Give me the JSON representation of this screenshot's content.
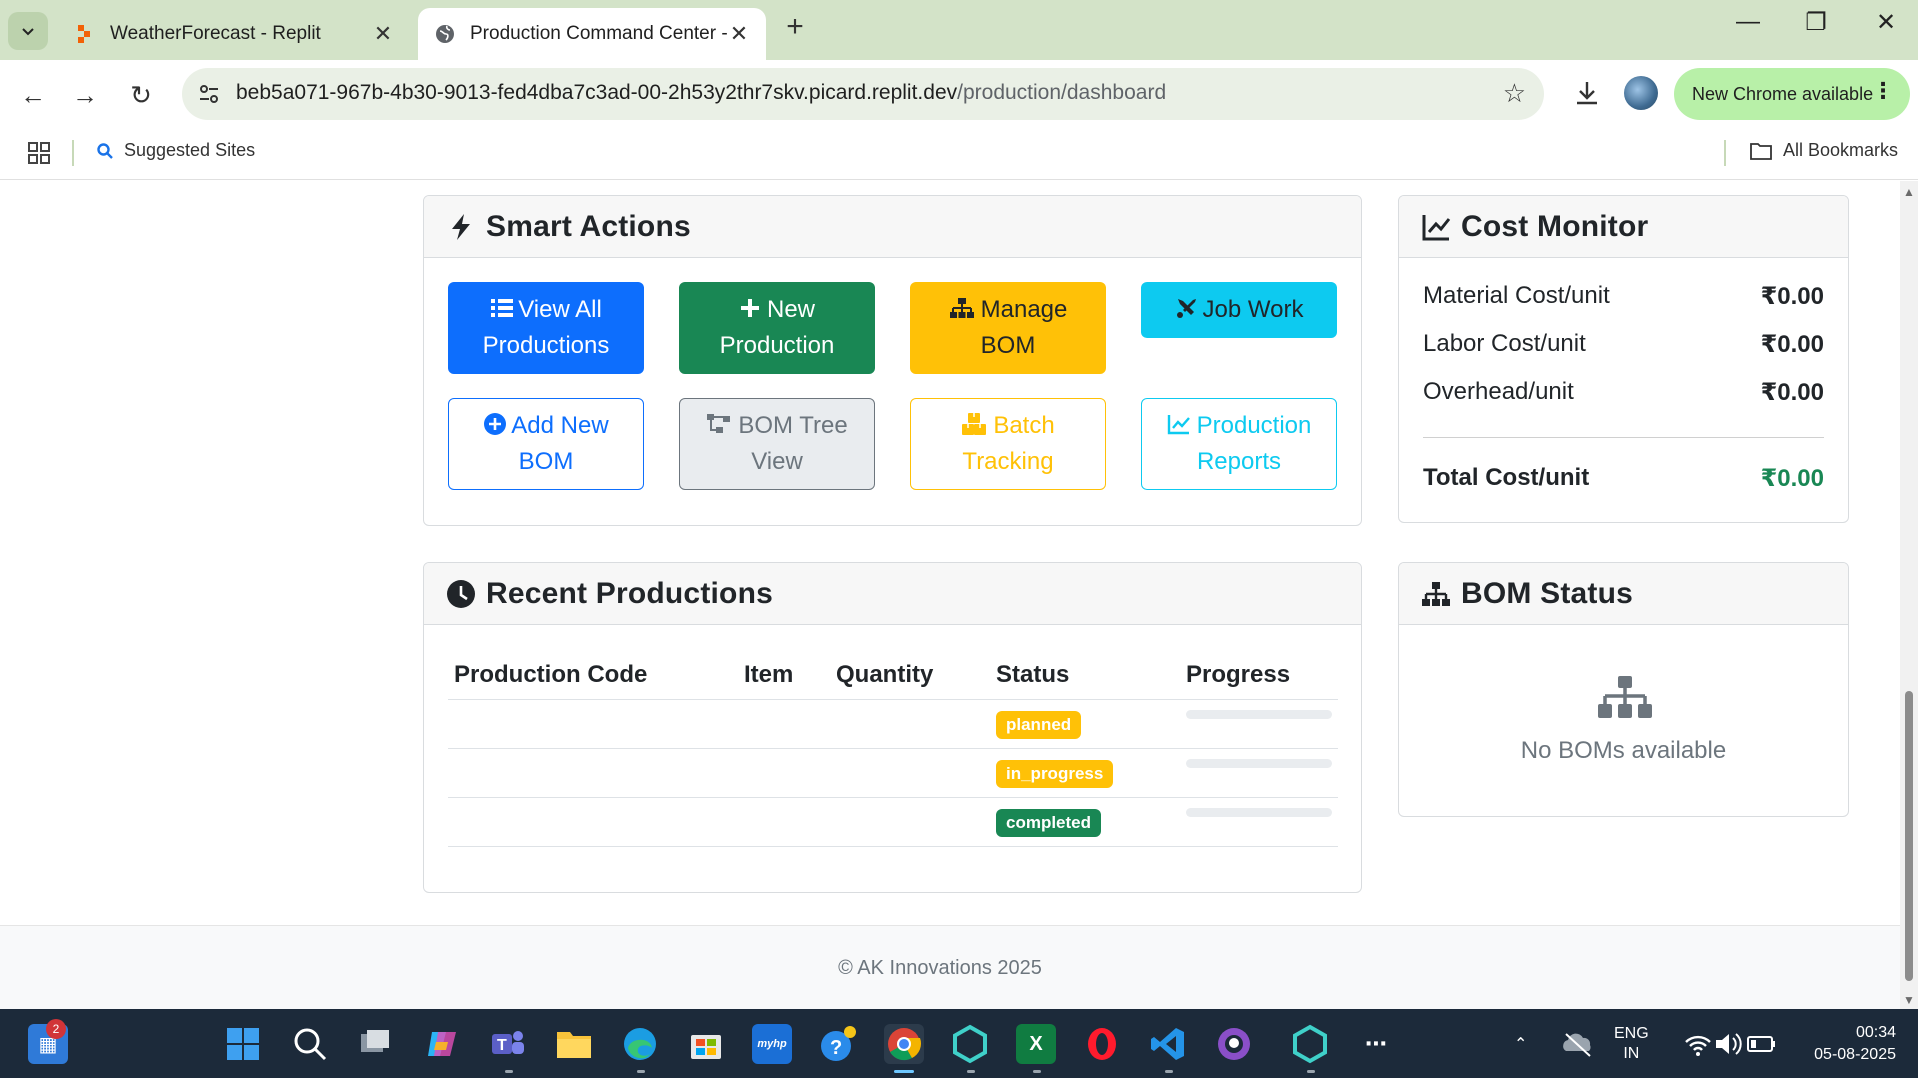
{
  "browser": {
    "tabs": [
      {
        "title": "WeatherForecast - Replit",
        "active": false
      },
      {
        "title": "Production Command Center -",
        "active": true
      }
    ],
    "url_host": "beb5a071-967b-4b30-9013-fed4dba7c3ad-00-2h53y2thr7skv.picard.replit.dev",
    "url_path": "/production/dashboard",
    "update_label": "New Chrome available",
    "bookmarks": {
      "suggested": "Suggested Sites",
      "all": "All Bookmarks"
    }
  },
  "smart_actions": {
    "title": "Smart Actions",
    "buttons": [
      {
        "label": "View All Productions",
        "style": "primary",
        "icon": "list-icon"
      },
      {
        "label": "New Production",
        "style": "success",
        "icon": "plus-icon"
      },
      {
        "label": "Manage BOM",
        "style": "warning",
        "icon": "sitemap-icon"
      },
      {
        "label": "Job Work",
        "style": "info",
        "icon": "tools-icon"
      },
      {
        "label": "Add New BOM",
        "style": "outline-primary",
        "icon": "plus-circle-icon"
      },
      {
        "label": "BOM Tree View",
        "style": "outline-secondary",
        "icon": "tree-icon"
      },
      {
        "label": "Batch Tracking",
        "style": "outline-warning",
        "icon": "boxes-icon"
      },
      {
        "label": "Production Reports",
        "style": "outline-info",
        "icon": "chart-line-icon"
      }
    ]
  },
  "cost_monitor": {
    "title": "Cost Monitor",
    "rows": [
      {
        "label": "Material Cost/unit",
        "value": "₹0.00"
      },
      {
        "label": "Labor Cost/unit",
        "value": "₹0.00"
      },
      {
        "label": "Overhead/unit",
        "value": "₹0.00"
      }
    ],
    "total": {
      "label": "Total Cost/unit",
      "value": "₹0.00"
    },
    "total_color": "#198754"
  },
  "recent_productions": {
    "title": "Recent Productions",
    "columns": [
      "Production Code",
      "Item",
      "Quantity",
      "Status",
      "Progress"
    ],
    "rows": [
      {
        "code": "",
        "item": "",
        "quantity": "",
        "status": "planned",
        "status_color": "#ffc107",
        "progress": 0
      },
      {
        "code": "",
        "item": "",
        "quantity": "",
        "status": "in_progress",
        "status_color": "#ffc107",
        "progress": 0
      },
      {
        "code": "",
        "item": "",
        "quantity": "",
        "status": "completed",
        "status_color": "#198754",
        "progress": 0
      }
    ]
  },
  "bom_status": {
    "title": "BOM Status",
    "empty_text": "No BOMs available"
  },
  "footer": {
    "text": "© AK Innovations 2025"
  },
  "taskbar": {
    "notification_count": "2",
    "lang": "ENG",
    "region": "IN",
    "time": "00:34",
    "date": "05-08-2025"
  }
}
